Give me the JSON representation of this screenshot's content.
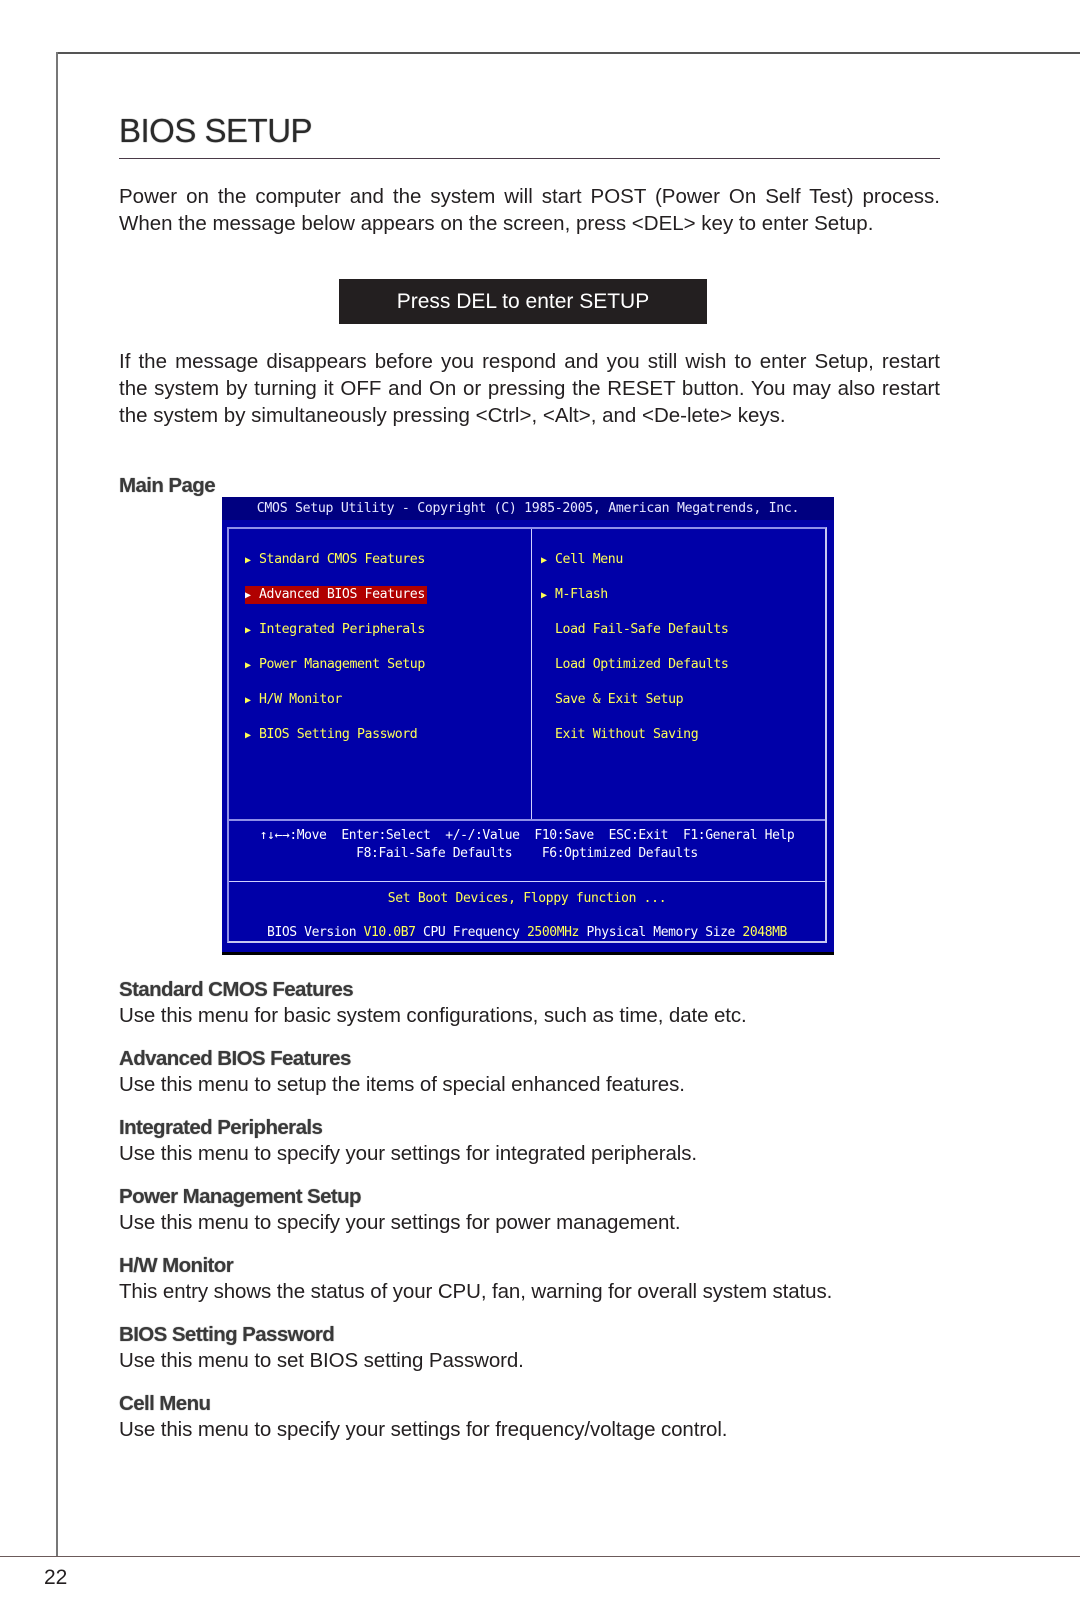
{
  "page": {
    "title": "BIOS SETUP",
    "page_number": "22",
    "intro_paragraph": "Power on the computer and the system will start POST (Power On Self Test) process. When the message below appears on the screen, press <DEL> key to enter Setup.",
    "del_banner": "Press DEL to enter SETUP",
    "restart_paragraph": "If the message disappears before you respond and you still wish to enter Setup, restart the system by turning it OFF and On or pressing the RESET button. You may also restart the system by simultaneously pressing <Ctrl>, <Alt>, and <De-lete> keys.",
    "main_page_heading": "Main Page"
  },
  "bios": {
    "title": "CMOS Setup Utility - Copyright (C) 1985-2005, American Megatrends, Inc.",
    "colors": {
      "background": "#0000a8",
      "title_bar": "#000080",
      "item_text": "#ffff55",
      "selected_bg": "#b00000"
    },
    "left_menu": [
      {
        "label": "Standard CMOS Features",
        "arrow": true,
        "selected": false
      },
      {
        "label": "Advanced BIOS Features",
        "arrow": true,
        "selected": true
      },
      {
        "label": "Integrated Peripherals",
        "arrow": true,
        "selected": false
      },
      {
        "label": "Power Management Setup",
        "arrow": true,
        "selected": false
      },
      {
        "label": "H/W Monitor",
        "arrow": true,
        "selected": false
      },
      {
        "label": "BIOS Setting Password",
        "arrow": true,
        "selected": false
      }
    ],
    "right_menu": [
      {
        "label": "Cell Menu",
        "arrow": true
      },
      {
        "label": "M-Flash",
        "arrow": true
      },
      {
        "label": "Load Fail-Safe Defaults",
        "arrow": false
      },
      {
        "label": "Load Optimized Defaults",
        "arrow": false
      },
      {
        "label": "Save & Exit Setup",
        "arrow": false
      },
      {
        "label": "Exit Without Saving",
        "arrow": false
      }
    ],
    "help_line1": "↑↓←→:Move  Enter:Select  +/-/:Value  F10:Save  ESC:Exit  F1:General Help",
    "help_line2": "F8:Fail-Safe Defaults    F6:Optimized Defaults",
    "item_description": "Set Boot Devices, Floppy function ...",
    "info": {
      "bios_version_label": "BIOS Version",
      "bios_version": "V10.0B7",
      "cpu_frequency_label": "CPU Frequency",
      "cpu_frequency": "2500MHz",
      "memory_label": "Physical Memory Size",
      "memory_size": "2048MB"
    }
  },
  "descriptions": [
    {
      "heading": "Standard CMOS Features",
      "text": "Use this menu for basic system configurations, such as time, date etc."
    },
    {
      "heading": "Advanced BIOS Features",
      "text": "Use this menu to setup the items of special enhanced features."
    },
    {
      "heading": "Integrated Peripherals",
      "text": "Use this menu to specify your settings for integrated peripherals."
    },
    {
      "heading": "Power Management Setup",
      "text": "Use this menu to specify your settings for power management."
    },
    {
      "heading": "H/W Monitor",
      "text": "This entry shows the status of your CPU, fan, warning for overall system status."
    },
    {
      "heading": "BIOS Setting Password",
      "text": "Use this menu to set BIOS setting Password."
    },
    {
      "heading": "Cell Menu",
      "text": "Use this menu to specify your settings for frequency/voltage control."
    }
  ]
}
